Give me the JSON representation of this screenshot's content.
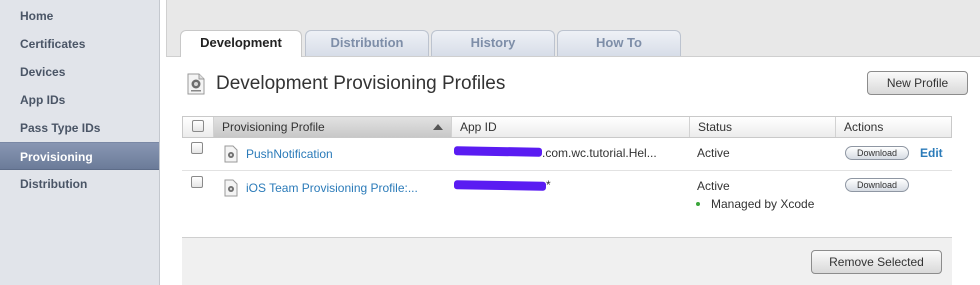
{
  "sidebar": {
    "items": [
      {
        "label": "Home"
      },
      {
        "label": "Certificates"
      },
      {
        "label": "Devices"
      },
      {
        "label": "App IDs"
      },
      {
        "label": "Pass Type IDs"
      },
      {
        "label": "Provisioning",
        "active": true
      },
      {
        "label": "Distribution"
      }
    ]
  },
  "tabs": [
    {
      "label": "Development",
      "active": true
    },
    {
      "label": "Distribution"
    },
    {
      "label": "History"
    },
    {
      "label": "How To"
    }
  ],
  "main": {
    "title": "Development Provisioning Profiles",
    "new_profile_label": "New Profile",
    "remove_selected_label": "Remove Selected"
  },
  "table": {
    "columns": [
      "Provisioning Profile",
      "App ID",
      "Status",
      "Actions"
    ],
    "rows": [
      {
        "profile": "PushNotification",
        "app_id_suffix": ".com.wc.tutorial.Hel...",
        "status": "Active",
        "download_label": "Download",
        "edit_label": "Edit"
      },
      {
        "profile": "iOS Team Provisioning Profile:...",
        "app_id_suffix": "*",
        "status": "Active",
        "status_note": "Managed by Xcode",
        "download_label": "Download"
      }
    ]
  },
  "colors": {
    "link": "#2b7bb9",
    "sidebar_active": "#6b7b99",
    "redaction": "#5a1cf2"
  }
}
